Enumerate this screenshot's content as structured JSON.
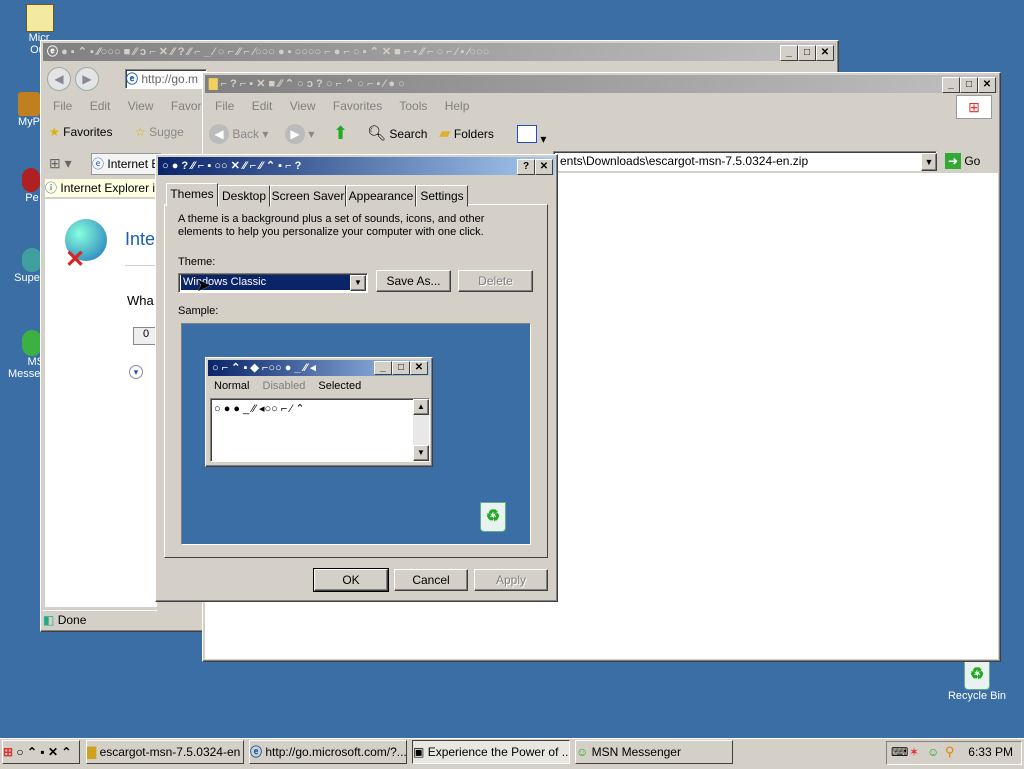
{
  "desktop": {
    "icons": [
      {
        "label": "Micr\nOut",
        "name": "outlook"
      },
      {
        "label": "MyP",
        "name": "mypictures"
      },
      {
        "label": "Pe",
        "name": "people"
      },
      {
        "label": "Supe",
        "name": "super"
      },
      {
        "label": "MS\nMesser",
        "name": "msn"
      }
    ],
    "recycle_bin": "Recycle Bin"
  },
  "ie_window": {
    "title": "● ▪ ⌃ ▪ ⁄⁄○○○ ■ ⁄⁄ ↄ ⌐ ✕ ⁄⁄ ? ⁄⁄ ⌐ _ ⁄ ○ ⌐ ⁄⁄ ⌐ ⁄○○○ ● ▪ ○○○○ ⌐ ● ⌐ ○ ▪ ⌃ ✕ ■ ⌐ ▪ ⁄⁄ ⌐ ○ ⌐ ⁄ ▪ ⁄○○○",
    "address": "http://go.m",
    "menu": [
      "File",
      "Edit",
      "View",
      "Favorites"
    ],
    "favorites": "Favorites",
    "suggested": "Sugge",
    "tab_label": "Internet E",
    "info_bar": "Internet Explorer is",
    "heading": "Inte",
    "subtext": "Wha",
    "button_text": "0",
    "status": "Done"
  },
  "explorer_window": {
    "title": "⌐ ? ⌐ ▪ ✕ ■ ⁄⁄ ⌃ ○ ↄ ? ○ ⌐ ⌃ ○ ⌐ ▪ ⁄ ● ○",
    "menu": [
      "File",
      "Edit",
      "View",
      "Favorites",
      "Tools",
      "Help"
    ],
    "back": "Back",
    "search": "Search",
    "folders": "Folders",
    "address": "ents\\Downloads\\escargot-msn-7.5.0324-en.zip",
    "go": "Go"
  },
  "dialog": {
    "title": "○ ● ? ⁄⁄ ⌐ ▪ ○○ ✕ ⁄⁄ ⌐ ⁄⁄ ⌃ ▪ ⌐ ?",
    "tabs": [
      "Themes",
      "Desktop",
      "Screen Saver",
      "Appearance",
      "Settings"
    ],
    "description": "A theme is a background plus a set of sounds, icons, and other elements to help you personalize your computer with one click.",
    "theme_label": "Theme:",
    "theme_value": "Windows Classic",
    "save_as": "Save As...",
    "delete": "Delete",
    "sample_label": "Sample:",
    "sample_window_title": "○ ⌐ ⌃ ▪ ◆ ⌐○○ ● _ ⁄⁄ ◂",
    "sample_menu": [
      "Normal",
      "Disabled",
      "Selected"
    ],
    "sample_text": "○ ● ● _ ⁄⁄ ◂○○ ⌐ ⁄ ⌃",
    "ok": "OK",
    "cancel": "Cancel",
    "apply": "Apply"
  },
  "taskbar": {
    "start": "○ ⌃ ▪ ✕ ⌃",
    "items": [
      "escargot-msn-7.5.0324-en",
      "http://go.microsoft.com/?...",
      "Experience the Power of ...",
      "MSN Messenger"
    ],
    "clock": "6:33 PM"
  }
}
